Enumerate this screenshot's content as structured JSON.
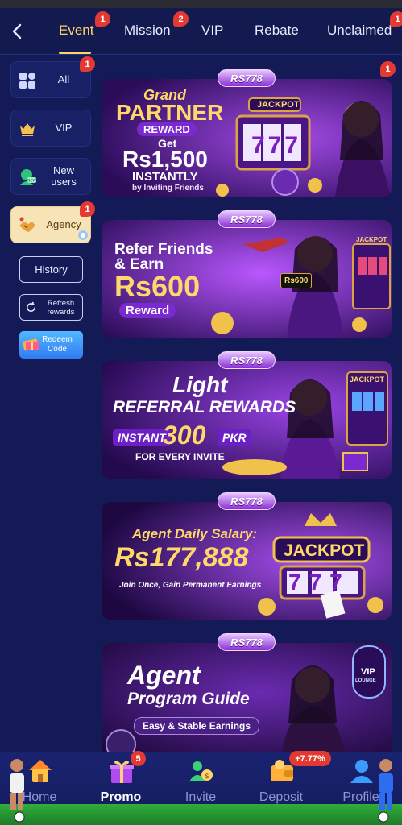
{
  "top_tabs": [
    {
      "label": "Event",
      "badge": "1"
    },
    {
      "label": "Mission",
      "badge": "2"
    },
    {
      "label": "VIP"
    },
    {
      "label": "Rebate"
    },
    {
      "label": "Unclaimed",
      "badge": "1"
    }
  ],
  "sidebar": {
    "items": [
      {
        "label": "All",
        "icon": "grid-icon",
        "badge": "1"
      },
      {
        "label": "VIP",
        "icon": "crown-icon"
      },
      {
        "label": "New users",
        "icon": "new-user-icon"
      },
      {
        "label": "Agency",
        "icon": "handshake-icon",
        "badge": "1"
      }
    ],
    "history_label": "History",
    "refresh_label": "Refresh rewards",
    "redeem_label": "Redeem Code"
  },
  "banners": [
    {
      "logo": "RS778",
      "badge": "1",
      "lines": [
        "Grand",
        "PARTNER",
        "REWARD",
        "Get",
        "Rs1,500",
        "INSTANTLY",
        "by Inviting Friends"
      ],
      "jackpot": "JACKPOT",
      "reel": "777"
    },
    {
      "logo": "RS778",
      "lines": [
        "Refer Friends",
        "& Earn",
        "Rs600",
        "Reward"
      ],
      "jackpot": "JACKPOT",
      "chip": "Rs600"
    },
    {
      "logo": "RS778",
      "lines": [
        "Light",
        "REFERRAL REWARDS",
        "INSTANT",
        "300",
        "PKR",
        "FOR EVERY INVITE"
      ],
      "jackpot": "JACKPOT"
    },
    {
      "logo": "RS778",
      "lines": [
        "Agent Daily Salary:",
        "Rs177,888",
        "Join Once, Gain Permanent Earnings"
      ],
      "jackpot": "JACKPOT",
      "reel": "777"
    },
    {
      "logo": "RS778",
      "lines": [
        "Agent",
        "Program Guide",
        "Easy & Stable Earnings"
      ],
      "vip": "VIP",
      "vip_sub": "LOUNGE"
    }
  ],
  "bottom_nav": [
    {
      "label": "Home",
      "icon": "home-icon"
    },
    {
      "label": "Promo",
      "icon": "gift-icon",
      "badge": "5"
    },
    {
      "label": "Invite",
      "icon": "invite-icon"
    },
    {
      "label": "Deposit",
      "icon": "wallet-icon",
      "badge": "+7.77%"
    },
    {
      "label": "Profile",
      "icon": "profile-icon"
    }
  ],
  "colors": {
    "bg": "#131a55",
    "accent": "#ffd36b",
    "badge": "#e23a32",
    "promo_purple": "#4b1a86"
  }
}
